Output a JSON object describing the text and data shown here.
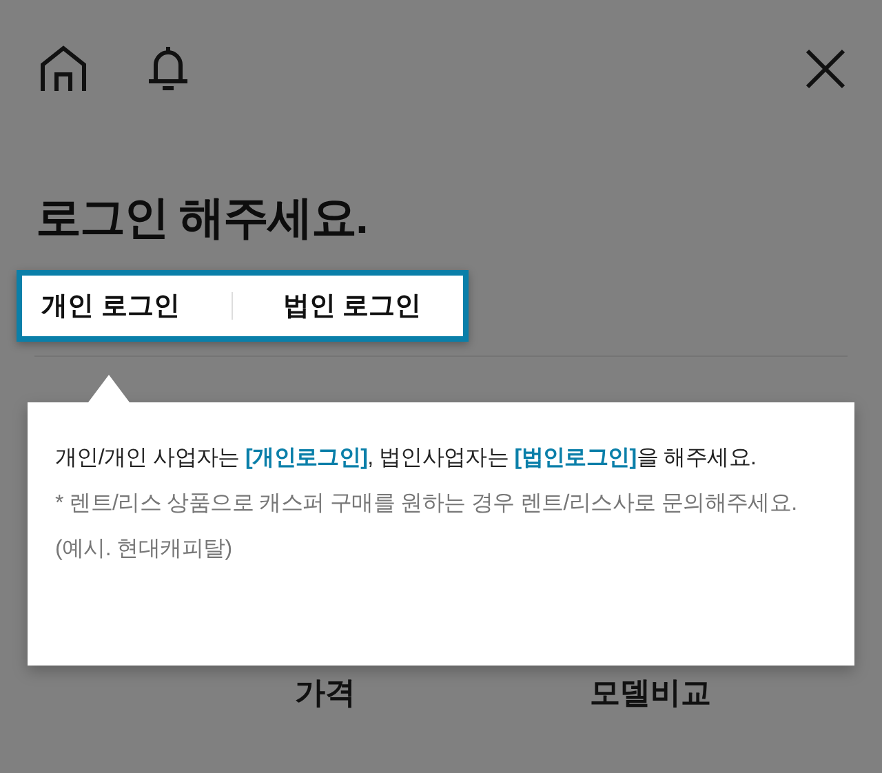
{
  "header": {
    "title": "**로그인** 해주세요."
  },
  "login_tabs": [
    {
      "label": "개인 로그인"
    },
    {
      "label": "법인 로그인"
    }
  ],
  "tooltip": {
    "message": "개인/개인 사업자는 **[개인로그인]**, 법인사업자는 **[법인로그인]**을 해주세요.",
    "note": "* 렌트/리스 상품으로 캐스퍼 구매를 원하는 경우 렌트/리스사로 문의해주세요. (예시. 현대캐피탈)"
  },
  "bottom_menu": [
    "가격",
    "모델비교"
  ]
}
